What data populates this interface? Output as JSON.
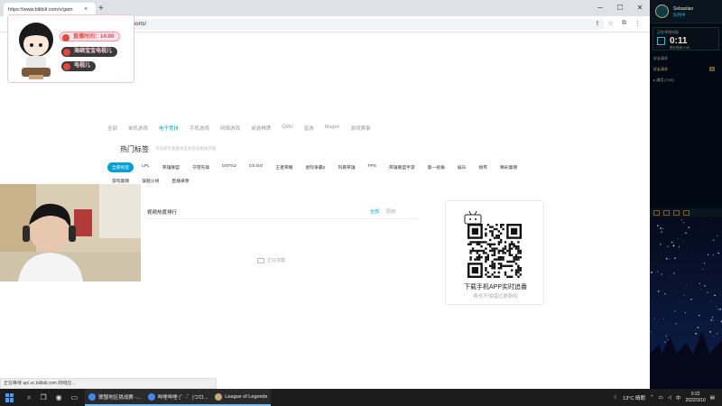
{
  "browser": {
    "tab_title": "https://www.bilibili.com/v/gam",
    "url": "bilibili.com/v/game/esports/",
    "status_url": "正在等待 api.vc.bilibili.com 的响应..."
  },
  "category_nav": [
    "全部",
    "单机游戏",
    "电子竞技",
    "手机游戏",
    "网络游戏",
    "桌游棋牌",
    "GMV",
    "音游",
    "Mugen",
    "游戏赛事"
  ],
  "category_nav_active_index": 2,
  "hot_tags": {
    "title": "热门标签",
    "description": "点击即可查看本区标签的相关内容",
    "tags": [
      "全部标签",
      "LPL",
      "英雄联盟",
      "守望先锋",
      "DOTA2",
      "CS:GO",
      "王者荣耀",
      "星际争霸2",
      "风暴英雄",
      "FPS",
      "英雄联盟手游",
      "第一视角",
      "娱乐",
      "搞笑",
      "精彩集锦",
      "游戏集锦",
      "穿越火线",
      "直播录像"
    ],
    "active_index": 0
  },
  "ranking": {
    "title": "视频热度排行",
    "tabs": [
      "全部",
      "原创"
    ],
    "active_index": 0,
    "loading_text": "正在加载"
  },
  "qr_card": {
    "title": "下载手机APP实时追番",
    "subtitle": "再也不怕错过更新啦"
  },
  "overlay": {
    "pill_time": "直播时间：14:00",
    "pill_1": "海绵宝宝电视儿",
    "pill_2": "电视儿"
  },
  "lol_sidebar": {
    "username": "Sebastian",
    "status": "队列中",
    "queue_label": "正在寻找对局",
    "timer": "0:11",
    "estimated": "预计时间 0:45",
    "line1": "好友请求",
    "line2": "好友请求",
    "badge": "0",
    "group": "▸ 通用 (7/40)"
  },
  "taskbar": {
    "apps": [
      {
        "label": "联盟地区挑战赛 -...",
        "color": "#4285f4",
        "open": true
      },
      {
        "label": "哔哩哔哩 (゜-゜)つロ...",
        "color": "#4285f4",
        "open": true
      },
      {
        "label": "League of Legends",
        "color": "#c8aa6e",
        "open": true
      }
    ],
    "weather": "13°C 晴朗",
    "lang": "中",
    "time": "0:22",
    "date": "2022/3/10"
  },
  "colors": {
    "accent": "#00a1d6",
    "sidebar_bg": "#010a13",
    "lol_gold": "#c8aa6e",
    "lol_cyan": "#0acbe6"
  }
}
